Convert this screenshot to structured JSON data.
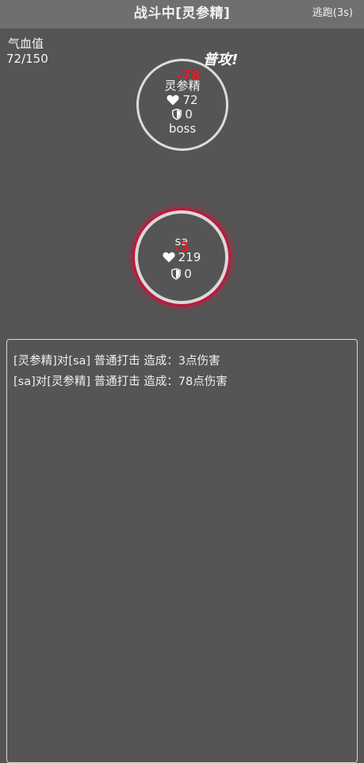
{
  "header": {
    "title": "战斗中[灵参精]",
    "escape_label": "逃跑(3s)"
  },
  "player_status": {
    "hp_label": "气血值",
    "hp_value": "72/150"
  },
  "boss": {
    "name": "灵参精",
    "hp": "72",
    "defense": "0",
    "tag": "boss",
    "damage_taken": "-78",
    "action_text": "普攻!"
  },
  "player": {
    "name": "sa",
    "hp": "219",
    "defense": "0",
    "damage_taken": "-3",
    "highlight_color": "#c3163b"
  },
  "battle_log": [
    "[灵参精]对[sa] 普通打击 造成：3点伤害",
    "[sa]对[灵参精] 普通打击 造成：78点伤害"
  ],
  "icons": {
    "heart": "heart-icon",
    "shield": "shield-icon"
  }
}
